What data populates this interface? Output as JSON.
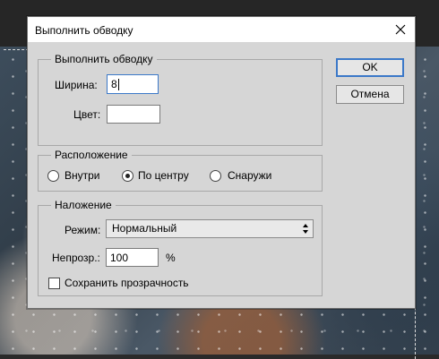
{
  "dialog": {
    "title": "Выполнить обводку",
    "ok_label": "OK",
    "cancel_label": "Отмена"
  },
  "stroke_group": {
    "legend": "Выполнить обводку",
    "width_label": "Ширина:",
    "width_value": "8",
    "color_label": "Цвет:",
    "color_value": "#ffffff"
  },
  "location_group": {
    "legend": "Расположение",
    "options": [
      {
        "label": "Внутри",
        "checked": false
      },
      {
        "label": "По центру",
        "checked": true
      },
      {
        "label": "Снаружи",
        "checked": false
      }
    ]
  },
  "blending_group": {
    "legend": "Наложение",
    "mode_label": "Режим:",
    "mode_value": "Нормальный",
    "opacity_label": "Непрозр.:",
    "opacity_value": "100",
    "opacity_unit": "%",
    "preserve_label": "Сохранить прозрачность",
    "preserve_checked": false
  },
  "icons": [
    "close-icon",
    "select-arrows-icon"
  ]
}
